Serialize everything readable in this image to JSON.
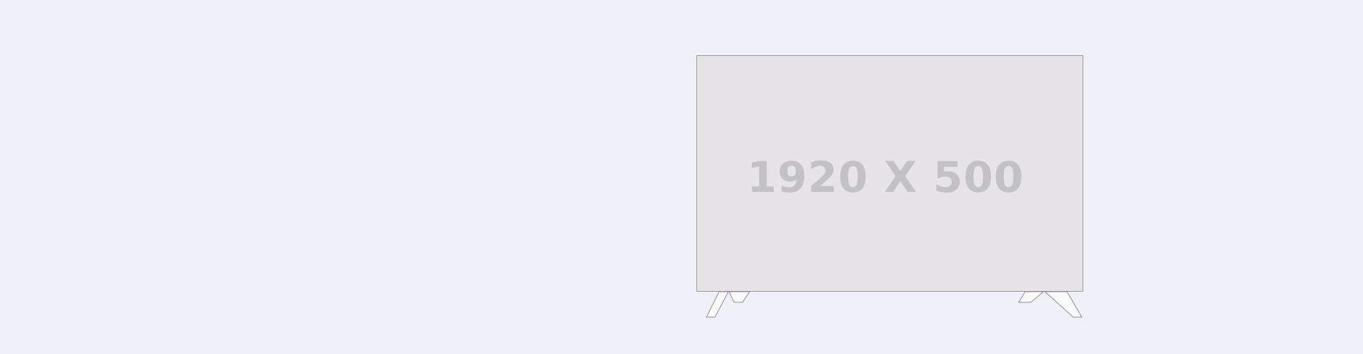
{
  "placeholder": {
    "label": "1920 X 500",
    "screen_color": "#e6e4e6",
    "background_color": "#f0f1f8",
    "text_color": "#c2c1c5"
  }
}
